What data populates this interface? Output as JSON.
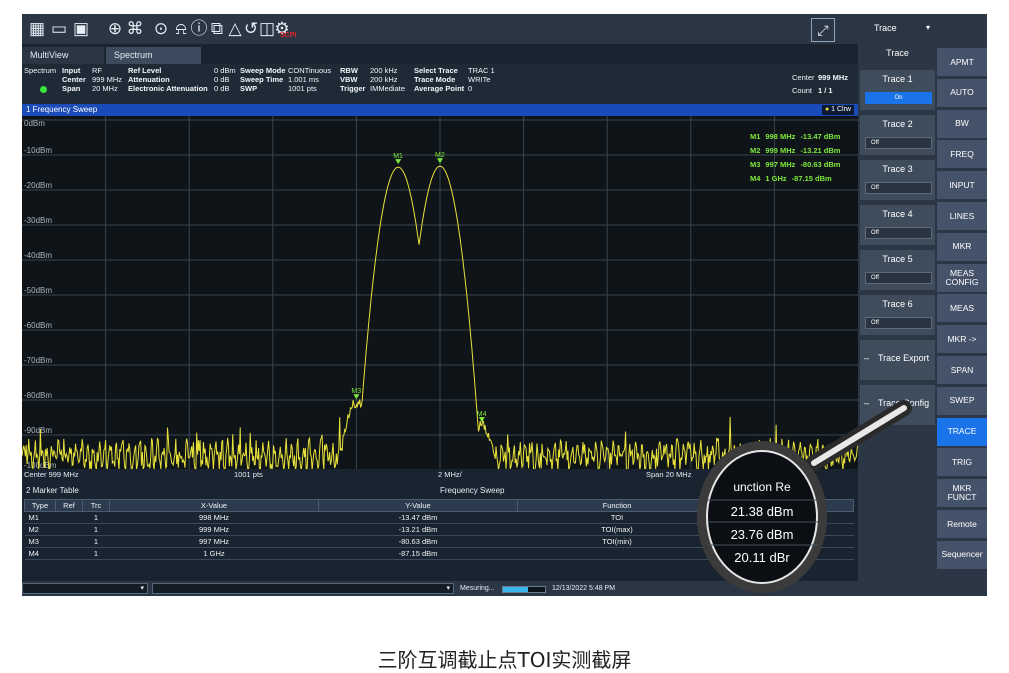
{
  "toolbar": {
    "icons": [
      "layout-icon",
      "file-icon",
      "save-icon",
      "zoom-icon",
      "zoom-fit-icon",
      "marker-icon",
      "wave-icon",
      "info-icon",
      "copy-icon",
      "warning-icon",
      "undo-icon",
      "book-icon",
      "settings-icon"
    ],
    "scpi": "SCPI"
  },
  "tabs": {
    "multiview": "MultiView",
    "spectrum": "Spectrum"
  },
  "info": {
    "spectrum": "Spectrum",
    "input_label": "Input",
    "input_value": "RF",
    "ref_label": "Ref Level",
    "ref_value": "0 dBm",
    "center_label": "Center",
    "center_value": "999 MHz",
    "att_label": "Attenuation",
    "att_value": "0 dB",
    "span_label": "Span",
    "span_value": "20 MHz",
    "eatt_label": "Electronic Attenuation",
    "eatt_value": "0 dB",
    "sweepmode_label": "Sweep Mode",
    "sweepmode_value": "CONTinuous",
    "sweeptime_label": "Sweep Time",
    "sweeptime_value": "1.001 ms",
    "swp_label": "SWP",
    "swp_value": "1001 pts",
    "rbw_label": "RBW",
    "rbw_value": "200 kHz",
    "vbw_label": "VBW",
    "vbw_value": "200 kHz",
    "trigger_label": "Trigger",
    "trigger_value": "IMMediate",
    "seltrace_label": "Select Trace",
    "seltrace_value": "TRAC 1",
    "tracemode_label": "Trace Mode",
    "tracemode_value": "WRITe",
    "avg_label": "Average Point",
    "avg_value": "0",
    "center_right_label": "Center",
    "center_right_value": "999 MHz",
    "count_label": "Count",
    "count_value": "1 / 1"
  },
  "freq_sweep": {
    "title": "1  Frequency Sweep",
    "trace_badge": "1 Clrw"
  },
  "y_ticks": [
    "0dBm",
    "-10dBm",
    "-20dBm",
    "-30dBm",
    "-40dBm",
    "-50dBm",
    "-60dBm",
    "-70dBm",
    "-80dBm",
    "-90dBm",
    "-100dBm"
  ],
  "marker_readout": [
    {
      "label": "M1",
      "freq": "998 MHz",
      "level": "-13.47 dBm"
    },
    {
      "label": "M2",
      "freq": "999 MHz",
      "level": "-13.21 dBm"
    },
    {
      "label": "M3",
      "freq": "997 MHz",
      "level": "-80.63 dBm"
    },
    {
      "label": "M4",
      "freq": "1 GHz",
      "level": "-87.15 dBm"
    }
  ],
  "marker_flags": [
    "M1",
    "M2",
    "M3",
    "M4"
  ],
  "xaxis": {
    "center": "Center  999 MHz",
    "pts": "1001 pts",
    "div": "2 MHz/",
    "span": "Span  20 MHz"
  },
  "marker_table": {
    "title_left": "2  Marker Table",
    "title_center": "Frequency Sweep",
    "headers": [
      "Type",
      "Ref",
      "Trc",
      "X-Value",
      "Y-Value",
      "Function",
      "Function Result"
    ],
    "rows": [
      [
        "M1",
        "",
        "1",
        "998 MHz",
        "-13.47 dBm",
        "TOI",
        "21.38 dBm"
      ],
      [
        "M2",
        "",
        "1",
        "999 MHz",
        "-13.21 dBm",
        "TOI(max)",
        "23.76 dBm"
      ],
      [
        "M3",
        "",
        "1",
        "997 MHz",
        "-80.63 dBm",
        "TOI(min)",
        "20.11 dBm"
      ],
      [
        "M4",
        "",
        "1",
        "1 GHz",
        "-87.15 dBm",
        "",
        ""
      ]
    ]
  },
  "magnifier": {
    "header": "unction Re",
    "values": [
      "21.38 dBm",
      "23.76 dBm",
      "20.11 dBr"
    ]
  },
  "status": {
    "measuring": "Mesuring...",
    "datetime": "12/13/2022 5:48 PM",
    "progress": 0.6
  },
  "side_panel": {
    "dropdown": "Trace",
    "header": "Trace",
    "traces": [
      {
        "label": "Trace 1",
        "state": "On"
      },
      {
        "label": "Trace 2",
        "state": "Off"
      },
      {
        "label": "Trace 3",
        "state": "Off"
      },
      {
        "label": "Trace 4",
        "state": "Off"
      },
      {
        "label": "Trace 5",
        "state": "Off"
      },
      {
        "label": "Trace 6",
        "state": "Off"
      }
    ],
    "export": "Trace Export",
    "config": "Trace Config"
  },
  "softkeys": [
    "APMT",
    "AUTO",
    "BW",
    "FREQ",
    "INPUT",
    "LINES",
    "MKR",
    "MEAS CONFIG",
    "MEAS",
    "MKR ->",
    "SPAN",
    "SWEP",
    "TRACE",
    "TRIG",
    "MKR FUNCT",
    "Remote",
    "Sequencer"
  ],
  "softkey_active": "TRACE",
  "caption": "三阶互调截止点TOI实测截屏",
  "colors": {
    "trace": "#e8e23a",
    "marker_text": "#7ee83c",
    "accent": "#1a73e8"
  }
}
